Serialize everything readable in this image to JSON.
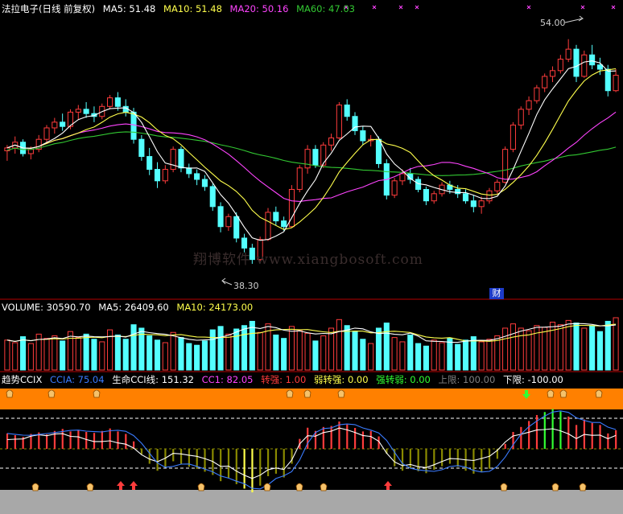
{
  "main_legend": {
    "title": "法拉电子(日线 前复权)",
    "ma5": "MA5: 51.48",
    "ma10": "MA10: 51.48",
    "ma20": "MA20: 50.16",
    "ma60": "MA60: 47.03"
  },
  "volume_legend": {
    "volume": "VOLUME: 30590.70",
    "ma5": "MA5: 26409.60",
    "ma10": "MA10: 24173.00"
  },
  "indicator_legend": {
    "name": "趋势CCIX",
    "ccia": "CCIA: 75.04",
    "life_cci": "生命CCI线: 151.32",
    "cc1": "CC1: 82.05",
    "weak_to_strong_label": "转强: 1.00",
    "weak_to_strong2": "弱转强: 0.00",
    "strong_to_weak": "强转弱: 0.00",
    "upper": "上限: 100.00",
    "lower": "下限: -100.00"
  },
  "annotations": {
    "high_price": "54.00",
    "low_price": "38.30",
    "finance_marker": "财",
    "watermark": "翔博软件 www.xiangbosoft.com"
  },
  "colors": {
    "up": "#ff3c3c",
    "down": "#54ffff",
    "ma5": "#ffffff",
    "ma10": "#ffff4c",
    "ma20": "#ff44ff",
    "ma60": "#32c832",
    "orange_band": "#ff8000",
    "gray_band": "#a8a8a8",
    "olive_bar": "#8a8a00"
  },
  "chart_data": [
    {
      "type": "candlestick",
      "title": "法拉电子(日线 前复权)",
      "series_names": [
        "MA5",
        "MA10",
        "MA20",
        "MA60"
      ],
      "ylim": [
        36.5,
        55.5
      ],
      "high_mark": 54.0,
      "low_mark": 38.3,
      "ohlc": [
        [
          46.2,
          46.6,
          45.5,
          46.4
        ],
        [
          46.4,
          47.2,
          46.0,
          46.8
        ],
        [
          46.8,
          47.0,
          45.8,
          46.0
        ],
        [
          46.0,
          46.5,
          45.6,
          46.3
        ],
        [
          46.3,
          47.3,
          46.1,
          47.0
        ],
        [
          47.0,
          48.0,
          46.8,
          47.8
        ],
        [
          47.8,
          48.5,
          47.4,
          48.2
        ],
        [
          48.2,
          48.8,
          47.6,
          47.9
        ],
        [
          47.9,
          49.1,
          47.7,
          48.9
        ],
        [
          48.9,
          49.4,
          48.4,
          49.1
        ],
        [
          49.1,
          49.6,
          48.5,
          48.8
        ],
        [
          48.8,
          49.3,
          48.2,
          48.6
        ],
        [
          48.6,
          49.5,
          48.4,
          49.3
        ],
        [
          49.3,
          50.1,
          49.1,
          49.9
        ],
        [
          49.9,
          50.3,
          49.0,
          49.3
        ],
        [
          49.3,
          49.8,
          48.6,
          48.9
        ],
        [
          48.9,
          49.2,
          46.7,
          47.0
        ],
        [
          47.0,
          47.3,
          45.5,
          45.8
        ],
        [
          45.8,
          46.4,
          44.5,
          44.9
        ],
        [
          44.9,
          45.4,
          43.6,
          44.1
        ],
        [
          44.1,
          45.2,
          43.9,
          44.9
        ],
        [
          44.9,
          46.5,
          44.7,
          46.3
        ],
        [
          46.3,
          46.5,
          44.7,
          45.0
        ],
        [
          45.0,
          45.3,
          44.3,
          44.6
        ],
        [
          44.6,
          44.9,
          43.8,
          44.2
        ],
        [
          44.2,
          44.5,
          43.4,
          43.7
        ],
        [
          43.7,
          43.9,
          42.0,
          42.3
        ],
        [
          42.3,
          42.6,
          40.5,
          40.9
        ],
        [
          40.9,
          41.8,
          40.6,
          41.6
        ],
        [
          41.6,
          41.9,
          39.8,
          40.1
        ],
        [
          40.1,
          40.4,
          39.1,
          39.4
        ],
        [
          39.4,
          39.7,
          38.3,
          38.6
        ],
        [
          38.6,
          40.2,
          38.5,
          40.0
        ],
        [
          40.0,
          42.2,
          39.9,
          41.9
        ],
        [
          41.9,
          42.3,
          41.0,
          41.3
        ],
        [
          41.3,
          41.6,
          40.6,
          40.9
        ],
        [
          40.9,
          43.8,
          40.8,
          43.5
        ],
        [
          43.5,
          45.2,
          43.3,
          45.0
        ],
        [
          45.0,
          46.6,
          44.6,
          46.3
        ],
        [
          46.3,
          46.6,
          45.0,
          45.2
        ],
        [
          45.2,
          46.8,
          45.0,
          46.6
        ],
        [
          46.6,
          47.4,
          46.2,
          47.1
        ],
        [
          47.1,
          49.6,
          47.0,
          49.4
        ],
        [
          49.4,
          49.8,
          48.3,
          48.6
        ],
        [
          48.6,
          48.9,
          47.3,
          47.6
        ],
        [
          47.6,
          47.9,
          46.6,
          46.9
        ],
        [
          46.9,
          47.3,
          46.5,
          47.0
        ],
        [
          47.0,
          47.2,
          45.0,
          45.3
        ],
        [
          45.3,
          45.6,
          42.8,
          43.1
        ],
        [
          43.1,
          44.3,
          42.9,
          44.1
        ],
        [
          44.1,
          44.9,
          43.8,
          44.6
        ],
        [
          44.6,
          45.0,
          43.9,
          44.2
        ],
        [
          44.2,
          44.4,
          43.3,
          43.5
        ],
        [
          43.5,
          43.7,
          42.4,
          42.7
        ],
        [
          42.7,
          43.4,
          42.5,
          43.2
        ],
        [
          43.2,
          44.0,
          43.0,
          43.8
        ],
        [
          43.8,
          44.1,
          43.2,
          43.5
        ],
        [
          43.5,
          43.8,
          42.9,
          43.2
        ],
        [
          43.2,
          43.5,
          42.5,
          42.7
        ],
        [
          42.7,
          43.1,
          41.9,
          42.3
        ],
        [
          42.3,
          43.0,
          41.8,
          42.7
        ],
        [
          42.7,
          43.6,
          42.5,
          43.4
        ],
        [
          43.4,
          44.2,
          43.2,
          44.0
        ],
        [
          44.0,
          46.5,
          43.9,
          46.3
        ],
        [
          46.3,
          48.2,
          46.1,
          48.0
        ],
        [
          48.0,
          49.3,
          47.7,
          49.1
        ],
        [
          49.1,
          50.0,
          48.7,
          49.7
        ],
        [
          49.7,
          50.8,
          49.5,
          50.6
        ],
        [
          50.6,
          51.6,
          50.3,
          51.4
        ],
        [
          51.4,
          52.1,
          51.0,
          51.8
        ],
        [
          51.8,
          52.9,
          51.6,
          52.6
        ],
        [
          52.6,
          54.0,
          52.4,
          53.3
        ],
        [
          53.3,
          53.6,
          51.0,
          51.4
        ],
        [
          51.4,
          53.2,
          51.3,
          52.9
        ],
        [
          52.9,
          53.6,
          51.9,
          52.2
        ],
        [
          52.2,
          52.7,
          51.5,
          51.9
        ],
        [
          51.9,
          52.2,
          50.0,
          50.4
        ],
        [
          50.4,
          51.9,
          50.3,
          51.48
        ]
      ]
    },
    {
      "type": "bar",
      "title": "VOLUME",
      "series_names": [
        "VOLUME",
        "MA5",
        "MA10"
      ],
      "ylim": [
        0,
        32000
      ],
      "values": [
        17500,
        16000,
        19500,
        15500,
        21000,
        18500,
        20000,
        17000,
        22500,
        19000,
        21000,
        18000,
        16500,
        23500,
        20500,
        18000,
        26500,
        24500,
        20000,
        17500,
        16000,
        22000,
        19000,
        15500,
        14500,
        17000,
        23500,
        25500,
        21000,
        24000,
        26000,
        28500,
        22000,
        27000,
        20500,
        18500,
        25500,
        23000,
        21500,
        17000,
        20000,
        24500,
        29500,
        26000,
        22500,
        18000,
        15500,
        24500,
        27500,
        19000,
        16500,
        20500,
        15500,
        14000,
        17500,
        16000,
        18500,
        15000,
        17500,
        19500,
        16500,
        18000,
        20000,
        24500,
        27000,
        24500,
        23000,
        26000,
        25000,
        28000,
        26500,
        29000,
        27500,
        24500,
        26000,
        22500,
        28500,
        30590.7
      ]
    },
    {
      "type": "histogram",
      "title": "趋势CCIX",
      "series_names": [
        "CCIA",
        "生命CCI线",
        "CC1"
      ],
      "ylim": [
        -200,
        220
      ],
      "upper_limit": 100,
      "lower_limit": -100,
      "values": [
        62,
        55,
        48,
        60,
        66,
        58,
        72,
        80,
        70,
        76,
        68,
        64,
        72,
        82,
        70,
        60,
        30,
        -22,
        -60,
        -88,
        -74,
        -50,
        -60,
        -72,
        -80,
        -92,
        -105,
        -130,
        -118,
        -142,
        -160,
        -175,
        -148,
        -110,
        -100,
        -115,
        -60,
        40,
        85,
        72,
        88,
        92,
        110,
        98,
        84,
        70,
        72,
        50,
        -20,
        -70,
        -88,
        -76,
        -90,
        -98,
        -84,
        -70,
        -60,
        -72,
        -88,
        -100,
        -92,
        -80,
        -40,
        20,
        68,
        88,
        112,
        136,
        148,
        160,
        150,
        130,
        96,
        118,
        104,
        96,
        62,
        75.04
      ]
    }
  ]
}
